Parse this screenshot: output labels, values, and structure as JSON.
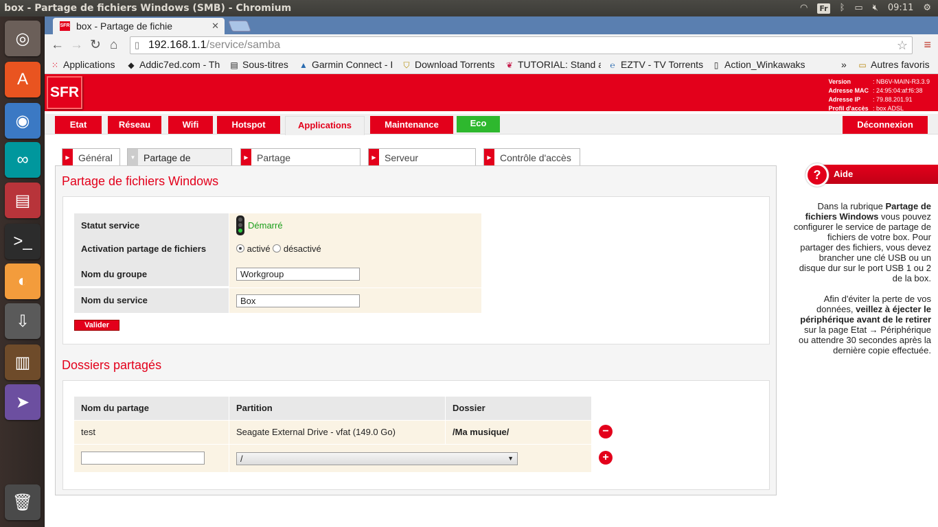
{
  "os": {
    "window_title": "box - Partage de fichiers Windows (SMB) - Chromium",
    "keyboard_layout": "Fr",
    "clock": "09:11"
  },
  "browser": {
    "tab_title": "box - Partage de fichie",
    "url_host": "192.168.1.1",
    "url_path": "/service/samba",
    "bookmarks_overflow": "»",
    "bookmarks": [
      {
        "label": "Applications",
        "icon": "apps-grid-icon"
      },
      {
        "label": "Addic7ed.com - Th",
        "icon": "addic7ed-icon"
      },
      {
        "label": "Sous-titres",
        "icon": "document-icon"
      },
      {
        "label": "Garmin Connect - I",
        "icon": "garmin-icon"
      },
      {
        "label": "Download Torrents",
        "icon": "shield-icon"
      },
      {
        "label": "TUTORIAL: Stand a",
        "icon": "raspberry-icon"
      },
      {
        "label": "EZTV - TV Torrents",
        "icon": "eztv-icon"
      },
      {
        "label": "Action_Winkawaks",
        "icon": "page-icon"
      },
      {
        "label": "Autres favoris",
        "icon": "folder-icon"
      }
    ]
  },
  "box": {
    "logo": "SFR",
    "info": [
      {
        "k": "Version",
        "v": ": NB6V-MAIN-R3.3.9"
      },
      {
        "k": "Adresse MAC",
        "v": ": 24:95:04:af:f6:38"
      },
      {
        "k": "Adresse IP",
        "v": ": 79.88.201.91"
      },
      {
        "k": "Profil d'accès",
        "v": ": box ADSL"
      }
    ],
    "nav": [
      "Etat",
      "Réseau",
      "Wifi",
      "Hotspot",
      "Applications",
      "Maintenance",
      "Eco"
    ],
    "logout": "Déconnexion",
    "subtabs": [
      "Général",
      "Partage de fichiers",
      "Partage d'imprimantes",
      "Serveur multimédia",
      "Contrôle d'accès"
    ]
  },
  "smb": {
    "title": "Partage de fichiers Windows",
    "status_label": "Statut service",
    "status_value": "Démarré",
    "activation_label": "Activation partage de fichiers",
    "radio_on": "activé",
    "radio_off": "désactivé",
    "group_label": "Nom du groupe",
    "group_value": "Workgroup",
    "service_label": "Nom du service",
    "service_value": "Box",
    "submit": "Valider"
  },
  "shares": {
    "title": "Dossiers partagés",
    "headers": [
      "Nom du partage",
      "Partition",
      "Dossier"
    ],
    "row": {
      "name": "test",
      "partition": "Seagate External Drive - vfat (149.0 Go)",
      "folder": "/Ma musique/"
    },
    "new_folder_selected": "/"
  },
  "help": {
    "title": "Aide",
    "p1_pre": "Dans la rubrique ",
    "p1_bold": "Partage de fichiers Windows",
    "p1_post": " vous pouvez configurer le service de partage de fichiers de votre box. Pour partager des fichiers, vous devez brancher une clé USB ou un disque dur sur le port USB 1 ou 2 de la box.",
    "p2_pre": "Afin d'éviter la perte de vos données, ",
    "p2_bold": "veillez à éjecter le périphérique avant de le retirer",
    "p2_post": " sur la page Etat → Périphérique ou attendre 30 secondes après la dernière copie effectuée."
  }
}
